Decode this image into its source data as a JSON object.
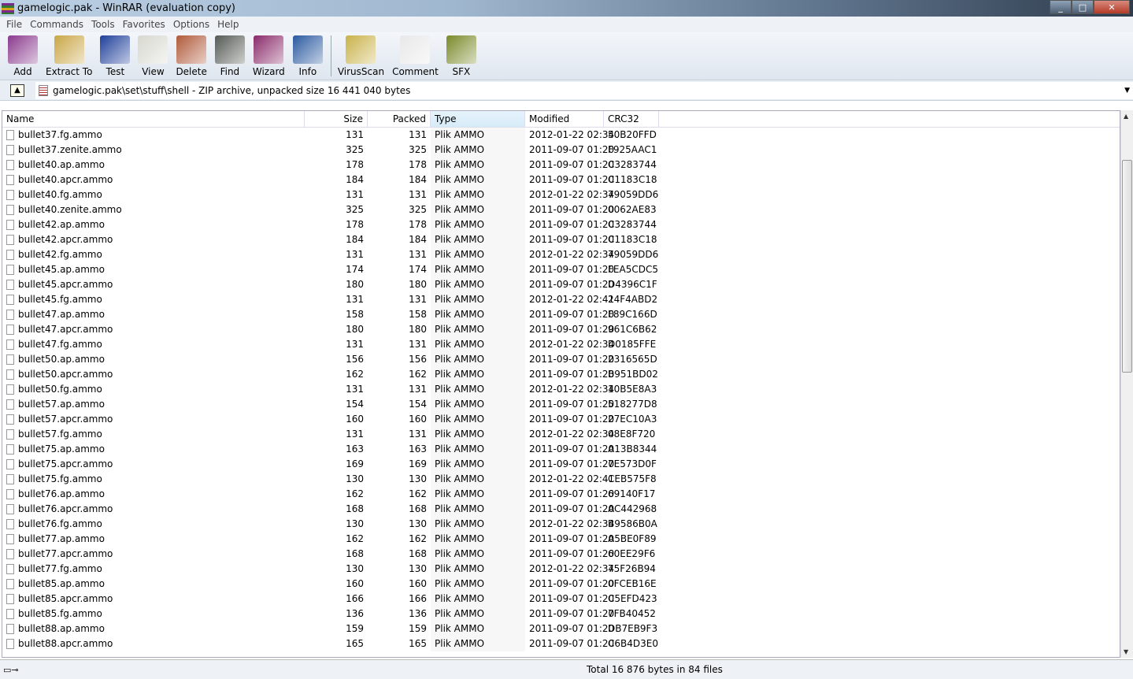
{
  "window": {
    "title": "gamelogic.pak - WinRAR (evaluation copy)"
  },
  "menu": [
    "File",
    "Commands",
    "Tools",
    "Favorites",
    "Options",
    "Help"
  ],
  "toolbar": [
    {
      "label": "Add",
      "color": "#8a3a8e"
    },
    {
      "label": "Extract To",
      "color": "#c9a646"
    },
    {
      "label": "Test",
      "color": "#1f3f9a"
    },
    {
      "label": "View",
      "color": "#d8d8d0"
    },
    {
      "label": "Delete",
      "color": "#b05a3a"
    },
    {
      "label": "Find",
      "color": "#555a55"
    },
    {
      "label": "Wizard",
      "color": "#8a2a6a"
    },
    {
      "label": "Info",
      "color": "#2a5aa0"
    },
    {
      "label": "VirusScan",
      "color": "#c9b24a"
    },
    {
      "label": "Comment",
      "color": "#e8e8e8"
    },
    {
      "label": "SFX",
      "color": "#7a8a2a"
    }
  ],
  "address": {
    "path": "gamelogic.pak\\set\\stuff\\shell - ZIP archive, unpacked size 16 441 040 bytes"
  },
  "columns": {
    "name": "Name",
    "size": "Size",
    "packed": "Packed",
    "type": "Type",
    "modified": "Modified",
    "crc": "CRC32"
  },
  "files": [
    [
      "bullet37.fg.ammo",
      "131",
      "131",
      "Plik AMMO",
      "2012-01-22 02:34",
      "50B20FFD"
    ],
    [
      "bullet37.zenite.ammo",
      "325",
      "325",
      "Plik AMMO",
      "2011-09-07 01:20",
      "F925AAC1"
    ],
    [
      "bullet40.ap.ammo",
      "178",
      "178",
      "Plik AMMO",
      "2011-09-07 01:20",
      "C3283744"
    ],
    [
      "bullet40.apcr.ammo",
      "184",
      "184",
      "Plik AMMO",
      "2011-09-07 01:20",
      "C1183C18"
    ],
    [
      "bullet40.fg.ammo",
      "131",
      "131",
      "Plik AMMO",
      "2012-01-22 02:34",
      "79059DD6"
    ],
    [
      "bullet40.zenite.ammo",
      "325",
      "325",
      "Plik AMMO",
      "2011-09-07 01:20",
      "0062AE83"
    ],
    [
      "bullet42.ap.ammo",
      "178",
      "178",
      "Plik AMMO",
      "2011-09-07 01:20",
      "C3283744"
    ],
    [
      "bullet42.apcr.ammo",
      "184",
      "184",
      "Plik AMMO",
      "2011-09-07 01:20",
      "C1183C18"
    ],
    [
      "bullet42.fg.ammo",
      "131",
      "131",
      "Plik AMMO",
      "2012-01-22 02:34",
      "79059DD6"
    ],
    [
      "bullet45.ap.ammo",
      "174",
      "174",
      "Plik AMMO",
      "2011-09-07 01:20",
      "FEA5CDC5"
    ],
    [
      "bullet45.apcr.ammo",
      "180",
      "180",
      "Plik AMMO",
      "2011-09-07 01:20",
      "D4396C1F"
    ],
    [
      "bullet45.fg.ammo",
      "131",
      "131",
      "Plik AMMO",
      "2012-01-22 02:41",
      "24F4ABD2"
    ],
    [
      "bullet47.ap.ammo",
      "158",
      "158",
      "Plik AMMO",
      "2011-09-07 01:20",
      "F89C166D"
    ],
    [
      "bullet47.apcr.ammo",
      "180",
      "180",
      "Plik AMMO",
      "2011-09-07 01:20",
      "961C6B62"
    ],
    [
      "bullet47.fg.ammo",
      "131",
      "131",
      "Plik AMMO",
      "2012-01-22 02:34",
      "D0185FFE"
    ],
    [
      "bullet50.ap.ammo",
      "156",
      "156",
      "Plik AMMO",
      "2011-09-07 01:20",
      "2316565D"
    ],
    [
      "bullet50.apcr.ammo",
      "162",
      "162",
      "Plik AMMO",
      "2011-09-07 01:20",
      "B951BD02"
    ],
    [
      "bullet50.fg.ammo",
      "131",
      "131",
      "Plik AMMO",
      "2012-01-22 02:34",
      "10B5E8A3"
    ],
    [
      "bullet57.ap.ammo",
      "154",
      "154",
      "Plik AMMO",
      "2011-09-07 01:20",
      "518277D8"
    ],
    [
      "bullet57.apcr.ammo",
      "160",
      "160",
      "Plik AMMO",
      "2011-09-07 01:20",
      "27EC10A3"
    ],
    [
      "bullet57.fg.ammo",
      "131",
      "131",
      "Plik AMMO",
      "2012-01-22 02:34",
      "08E8F720"
    ],
    [
      "bullet75.ap.ammo",
      "163",
      "163",
      "Plik AMMO",
      "2011-09-07 01:20",
      "A13B8344"
    ],
    [
      "bullet75.apcr.ammo",
      "169",
      "169",
      "Plik AMMO",
      "2011-09-07 01:20",
      "7E573D0F"
    ],
    [
      "bullet75.fg.ammo",
      "130",
      "130",
      "Plik AMMO",
      "2012-01-22 02:41",
      "CEB575F8"
    ],
    [
      "bullet76.ap.ammo",
      "162",
      "162",
      "Plik AMMO",
      "2011-09-07 01:20",
      "69140F17"
    ],
    [
      "bullet76.apcr.ammo",
      "168",
      "168",
      "Plik AMMO",
      "2011-09-07 01:20",
      "AC442968"
    ],
    [
      "bullet76.fg.ammo",
      "130",
      "130",
      "Plik AMMO",
      "2012-01-22 02:34",
      "B9586B0A"
    ],
    [
      "bullet77.ap.ammo",
      "162",
      "162",
      "Plik AMMO",
      "2011-09-07 01:20",
      "A5BE0F89"
    ],
    [
      "bullet77.apcr.ammo",
      "168",
      "168",
      "Plik AMMO",
      "2011-09-07 01:20",
      "60EE29F6"
    ],
    [
      "bullet77.fg.ammo",
      "130",
      "130",
      "Plik AMMO",
      "2012-01-22 02:34",
      "75F26B94"
    ],
    [
      "bullet85.ap.ammo",
      "160",
      "160",
      "Plik AMMO",
      "2011-09-07 01:20",
      "0FCEB16E"
    ],
    [
      "bullet85.apcr.ammo",
      "166",
      "166",
      "Plik AMMO",
      "2011-09-07 01:20",
      "C5EFD423"
    ],
    [
      "bullet85.fg.ammo",
      "136",
      "136",
      "Plik AMMO",
      "2011-09-07 01:20",
      "7FB40452"
    ],
    [
      "bullet88.ap.ammo",
      "159",
      "159",
      "Plik AMMO",
      "2011-09-07 01:20",
      "DB7EB9F3"
    ],
    [
      "bullet88.apcr.ammo",
      "165",
      "165",
      "Plik AMMO",
      "2011-09-07 01:20",
      "C6B4D3E0"
    ]
  ],
  "status": {
    "total": "Total 16 876 bytes in 84 files"
  }
}
